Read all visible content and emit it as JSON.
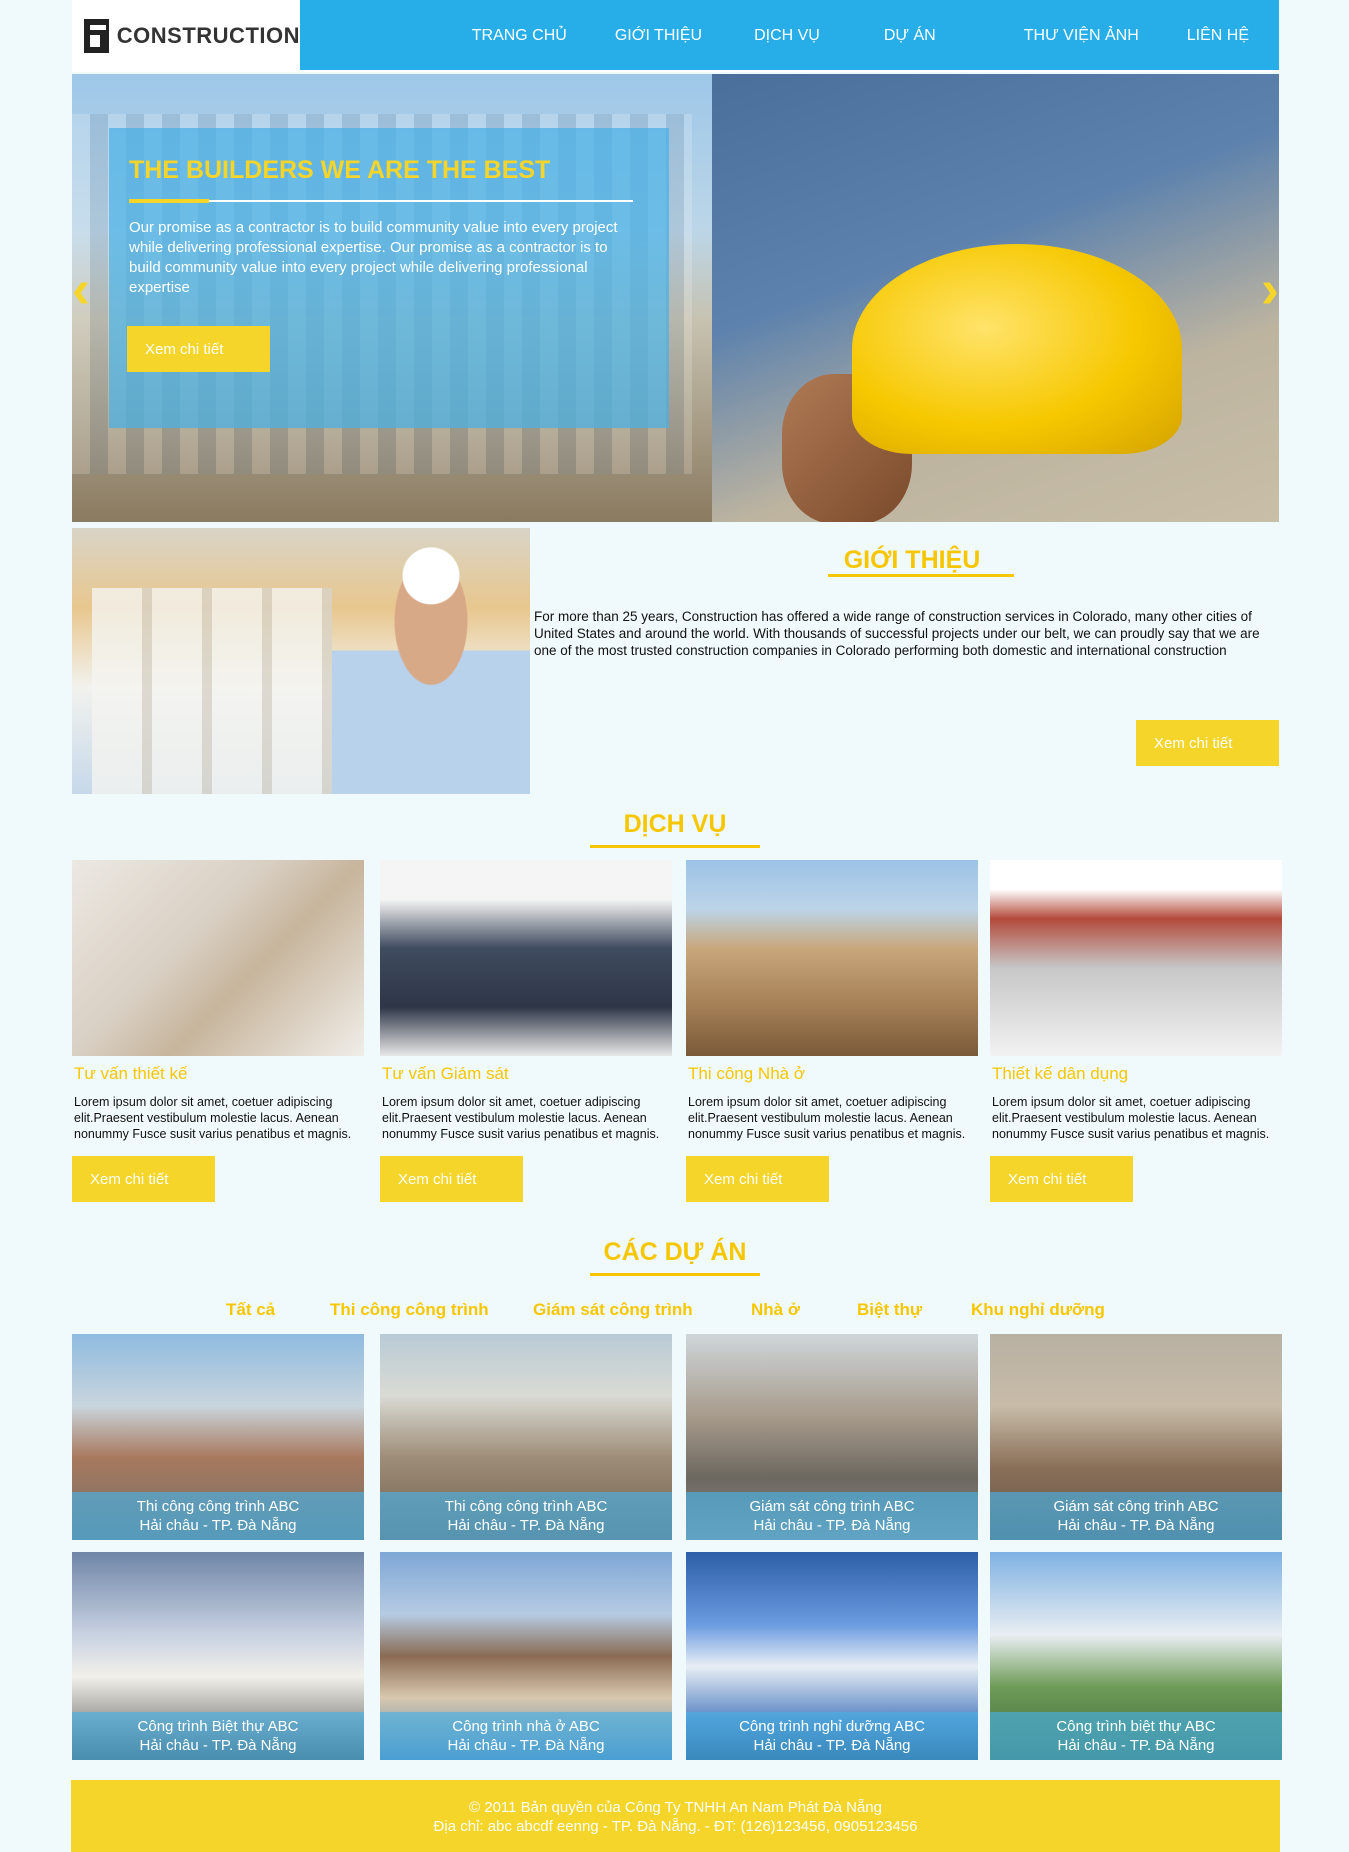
{
  "header": {
    "logo_text": "CONSTRUCTION",
    "nav": [
      "TRANG CHỦ",
      "GIỚI THIỆU",
      "DỊCH VỤ",
      "DỰ ÁN",
      "THƯ VIỆN ẢNH",
      "LIÊN HỆ"
    ]
  },
  "hero": {
    "title": "THE BUILDERS WE ARE THE BEST",
    "text": "Our promise as a contractor is to build community value into every project while delivering professional expertise. Our promise as a contractor is to build community value into every project while delivering professional expertise",
    "button": "Xem chi tiết",
    "prev_icon": "chevron-left-icon",
    "next_icon": "chevron-right-icon"
  },
  "intro": {
    "title": "GIỚI THIỆU",
    "text": "For more than 25 years, Construction has offered a wide range of construction services in Colorado, many other cities of United States and around the world. With thousands of successful projects under our belt, we can proudly say that we are one of the most trusted construction companies in Colorado performing both domestic and international construction",
    "button": "Xem chi tiết"
  },
  "services": {
    "title": "DỊCH VỤ",
    "items": [
      {
        "name": "Tư vấn thiết kế",
        "desc": "Lorem ipsum dolor sit amet, coetuer adipiscing elit.Praesent vestibulum molestie lacus. Aenean nonummy Fusce susit varius penatibus et magnis.",
        "button": "Xem chi tiết"
      },
      {
        "name": "Tư vấn Giám sát",
        "desc": "Lorem ipsum dolor sit amet, coetuer adipiscing elit.Praesent vestibulum molestie lacus. Aenean nonummy Fusce susit varius penatibus et magnis.",
        "button": "Xem chi tiết"
      },
      {
        "name": "Thi công Nhà ở",
        "desc": "Lorem ipsum dolor sit amet, coetuer adipiscing elit.Praesent vestibulum molestie lacus. Aenean nonummy Fusce susit varius penatibus et magnis.",
        "button": "Xem chi tiết"
      },
      {
        "name": "Thiết kế dân dụng",
        "desc": "Lorem ipsum dolor sit amet, coetuer adipiscing elit.Praesent vestibulum molestie lacus. Aenean nonummy Fusce susit varius penatibus et magnis.",
        "button": "Xem chi tiết"
      }
    ]
  },
  "projects": {
    "title": "CÁC DỰ ÁN",
    "filters": [
      "Tất cả",
      "Thi công công trình",
      "Giám sát công trình",
      "Nhà ở",
      "Biệt thự",
      "Khu nghỉ dưỡng"
    ],
    "items": [
      {
        "line1": "Thi công công trình ABC",
        "line2": "Hải châu - TP. Đà Nẵng"
      },
      {
        "line1": "Thi công công trình  ABC",
        "line2": "Hải châu - TP. Đà Nẵng"
      },
      {
        "line1": "Giám sát công trình ABC",
        "line2": "Hải châu - TP. Đà Nẵng"
      },
      {
        "line1": "Giám sát công trình ABC",
        "line2": "Hải châu - TP. Đà Nẵng"
      },
      {
        "line1": "Công trình Biệt thự ABC",
        "line2": "Hải châu - TP. Đà Nẵng"
      },
      {
        "line1": "Công trình nhà ở ABC",
        "line2": "Hải châu - TP. Đà Nẵng"
      },
      {
        "line1": "Công trình nghỉ dưỡng ABC",
        "line2": "Hải châu - TP. Đà Nẵng"
      },
      {
        "line1": "Công trình biệt thự ABC",
        "line2": "Hải châu - TP. Đà Nẵng"
      }
    ]
  },
  "footer": {
    "line1": "© 2011 Bản quyền của Công Ty  TNHH An Nam Phát Đà Nẵng",
    "line2": "Địa chỉ: abc abcdf eenng - TP. Đà Nẵng. - ĐT: (126)123456, 0905123456"
  },
  "colors": {
    "accent_yellow": "#f6d52b",
    "header_blue": "#27aee9",
    "background": "#f0f9fc"
  }
}
